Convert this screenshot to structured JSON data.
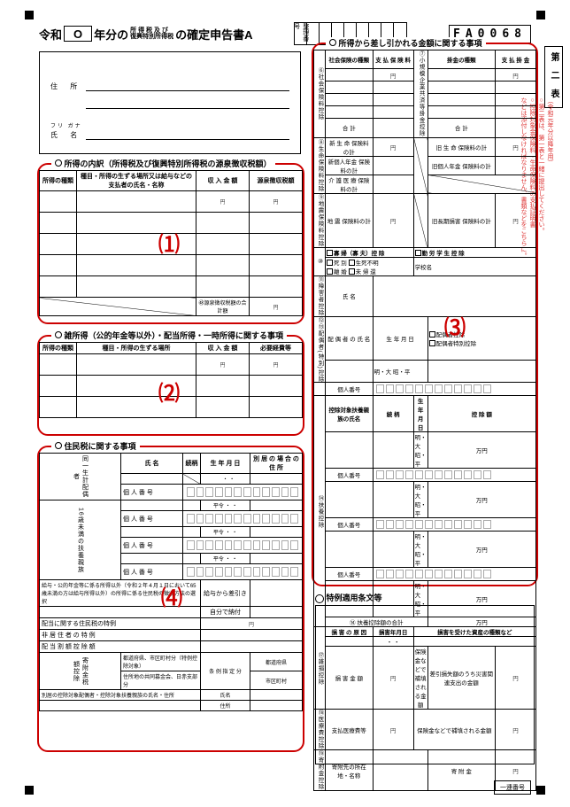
{
  "header": {
    "era": "令和",
    "year_prefix": "O",
    "title_mid_top": "所 得 税 及 び",
    "title_mid_bot": "復興特別所得税",
    "title_suffix": "の確定申告書A",
    "seiri_label": "整理番号",
    "fa_code": "FA0068"
  },
  "name_addr": {
    "addr_label": "住 所",
    "furigana": "フリ ガナ",
    "name_label": "氏 名"
  },
  "box1": {
    "title": "所得の内訳（所得税及び復興特別所得税の源泉徴収税額）",
    "cols": [
      "所得の種類",
      "種目・所得の生ずる場所又は給与などの支払者の氏名・名称",
      "収 入 金 額",
      "源泉徴収税額"
    ],
    "footer_label": "㊽源泉徴収税額の合計額",
    "num": "⑴"
  },
  "box2": {
    "title": "雑所得（公的年金等以外）・配当所得・一時所得に関する事項",
    "cols": [
      "所得の種類",
      "種目・所得の生ずる場所",
      "収 入 金 額",
      "必要経費等"
    ],
    "num": "⑵"
  },
  "box3": {
    "title": "所得から差し引かれる金額に関する事項",
    "num": "⑶",
    "left_vh1": "⑥社会保険料控除",
    "col_a1": "社会保険の種類",
    "col_a2": "支 払 保 険 料",
    "col_b1": "掛金の種類",
    "col_b2": "支 払 掛 金",
    "right_vh1": "⑦小規模企業共済等掛金控除",
    "goukei": "合 計",
    "left_vh2": "⑧生命保険料控除",
    "rows8": [
      "新 生 命 保険料の計",
      "新個人年金 保険料の計",
      "介 護 医 療 保険料の計"
    ],
    "rows8b": [
      "旧 生 命 保険料の計",
      "旧個人年金 保険料の計"
    ],
    "left_vh3": "⑨地震保険料控除",
    "row9a": "地 震 保険料の計",
    "row9b": "旧長期損害 保険料の計",
    "left_vh4_title": "寡 婦（寡 夫）控 除",
    "chk_a": "死 別",
    "chk_b": "生死不明",
    "chk_c": "離 婚",
    "chk_d": "未 帰 還",
    "left_vh5_title": "勤 労 学 生 控 除",
    "school": "学校名",
    "left_vh6": "⑪障害者控除",
    "name_lbl": "氏 名",
    "left_vh7": "⑫⑬配偶者(特別)控除",
    "spouse_name": "配 偶 者 の 氏 名",
    "birth": "生 年 月 日",
    "era_opts": "明・大\n昭・平",
    "spouse_a": "配偶者控除",
    "spouse_b": "配偶者特別控除",
    "mynum": "個人番号",
    "left_vh8": "⑭扶養控除",
    "fuyo_name": "控除対象扶養親族の氏名",
    "zokugara": "続 柄",
    "koujo": "控 除 額",
    "fuyo_total": "⑭ 扶養控除額の合計",
    "left_vh9": "⑰雑損控除",
    "songai_cause": "損 害 の 原 因",
    "songai_date": "損害年月日",
    "songai_asset": "損害を受けた資産の種類など",
    "songai_amt": "損 害 金 額",
    "hoken_comp": "保険金などで補填される金額",
    "saigai": "差引損失額のうち災害関連支出の金額",
    "left_vh10": "⑱医療費控除",
    "iryo_a": "支払医療費等",
    "iryo_b": "保険金などで補填される金額",
    "left_vh11": "⑲寄附金控除",
    "kifu_a": "寄附先の所在地・名称",
    "kifu_b": "寄 附 金"
  },
  "box4": {
    "title": "住民税に関する事項",
    "num": "⑷",
    "left_vh_a": "同一生計配偶者",
    "cols_a": [
      "氏 名",
      "続柄",
      "生 年 月 日",
      "別 居 の 場 合 の 住 所"
    ],
    "left_vh_b": "16歳未満の扶養親族",
    "mynum": "個 人 番 号",
    "era": "平令",
    "note": "給与・公的年金等に係る所得以外（令和２年４月１日において65歳未満の方は給与所得以外）の所得に係る住民税の徴収方法の選択",
    "opt_a": "給与から差引き",
    "opt_b": "自分で納付",
    "rows": [
      "配当に関する住民税の特例",
      "非 居 住 者 の 特 例",
      "配 当 割 額 控 除 額"
    ],
    "left_lbl_kifu": "寄附金税額控除",
    "kifu_rows_l": [
      "都道府県、市区町村分（特例控除対象）",
      "住所地の共同募金会、日赤支部分"
    ],
    "kifu_rows_r": [
      "条 例 指 定 分"
    ],
    "kifu_sub_r": [
      "都道府県",
      "市区町村"
    ],
    "bottom": "別居の控除対象配偶者・控除対象扶養親族の氏名・住所",
    "bottom_r": "氏名",
    "bottom_r2": "住所"
  },
  "tokure": "特例適用条文等",
  "vtab": "第 二 表",
  "vtext": [
    "（令和元年分以降年用）",
    "○第二表は、第一表と一緒に提出してください。",
    "○控除対象金保険料・生命保険料の支払証明書",
    "などは添付しなければなりません、書類などをこちらに。"
  ],
  "seal": "一連番号"
}
